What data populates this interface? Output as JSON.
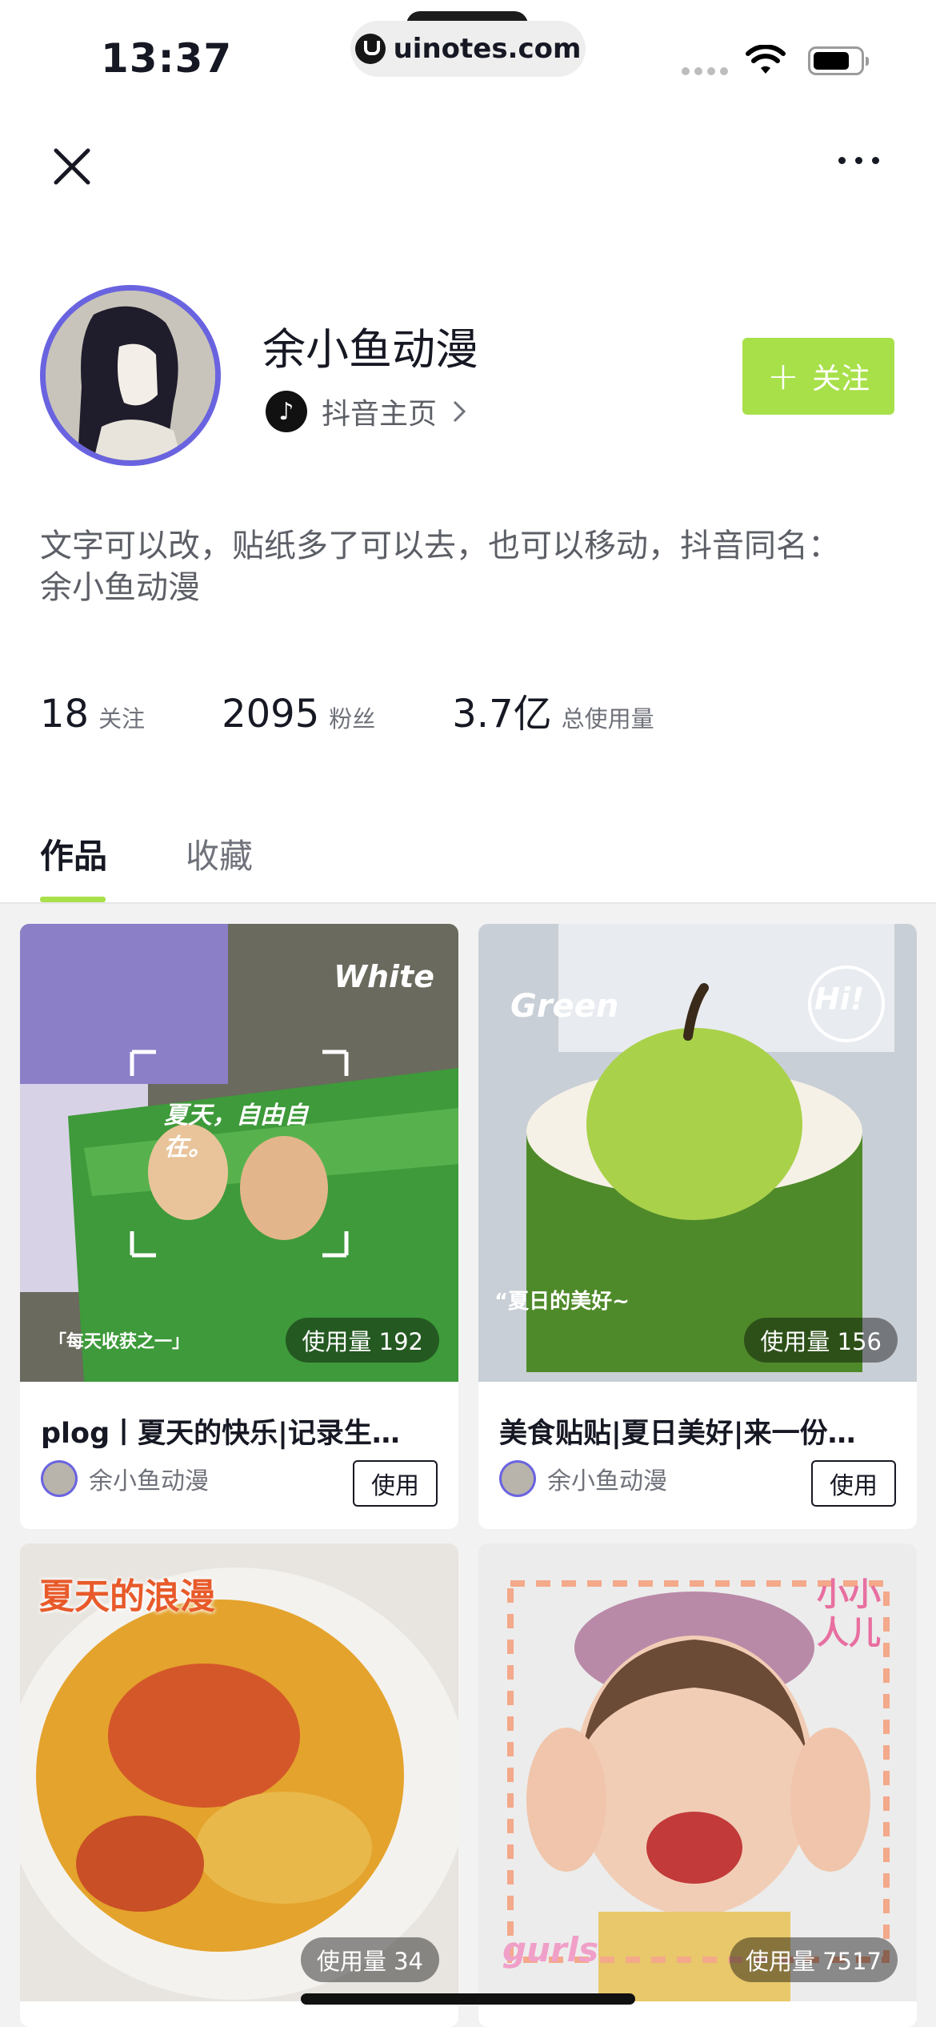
{
  "status_bar": {
    "time": "13:37",
    "url": "uinotes.com"
  },
  "profile": {
    "name": "余小鱼动漫",
    "douyin_link": "抖音主页",
    "follow_label": "关注",
    "bio": "文字可以改，贴纸多了可以去，也可以移动，抖音同名：余小鱼动漫",
    "stats": [
      {
        "value": "18",
        "label": "关注"
      },
      {
        "value": "2095",
        "label": "粉丝"
      },
      {
        "value": "3.7亿",
        "label": "总使用量"
      }
    ]
  },
  "tabs": {
    "works": "作品",
    "favorites": "收藏"
  },
  "cards": [
    {
      "usage": "使用量 192",
      "title": "plog丨夏天的快乐|记录生…",
      "author": "余小鱼动漫",
      "use_label": "使用",
      "sticker_1": "White",
      "sticker_2": "夏天，自由自在。",
      "sticker_3": "「每天收获之一」"
    },
    {
      "usage": "使用量 156",
      "title": "美食贴贴|夏日美好|来一份…",
      "author": "余小鱼动漫",
      "use_label": "使用",
      "sticker_1": "Green",
      "sticker_2": "Hi!",
      "sticker_3": "“夏日的美好~"
    },
    {
      "usage": "使用量 34",
      "sticker_1": "夏天的浪漫"
    },
    {
      "usage": "使用量 7517",
      "sticker_1": "小小人儿",
      "sticker_2": "gurls"
    }
  ],
  "colors": {
    "accent": "#a8e04a",
    "avatar_ring": "#6a63e0"
  }
}
